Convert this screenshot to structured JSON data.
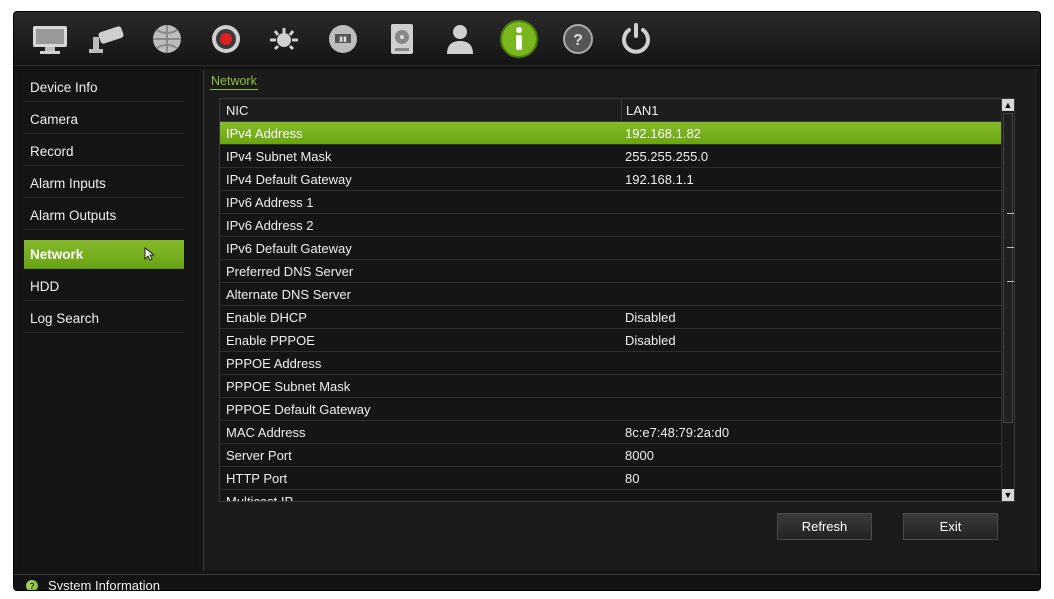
{
  "toolbar": {
    "icons": [
      {
        "name": "display-settings-icon"
      },
      {
        "name": "camera-setup-icon"
      },
      {
        "name": "network-settings-icon"
      },
      {
        "name": "recording-setup-icon"
      },
      {
        "name": "alarm-setup-icon"
      },
      {
        "name": "device-management-icon"
      },
      {
        "name": "hdd-storage-icon"
      },
      {
        "name": "user-management-icon"
      },
      {
        "name": "system-information-icon"
      },
      {
        "name": "help-icon"
      },
      {
        "name": "power-icon"
      }
    ],
    "active_icon": "system-information-icon",
    "accent_color": "#7ab61e"
  },
  "sidebar": {
    "items": [
      {
        "label": "Device Info"
      },
      {
        "label": "Camera"
      },
      {
        "label": "Record"
      },
      {
        "label": "Alarm Inputs"
      },
      {
        "label": "Alarm Outputs"
      },
      {
        "label": "Network"
      },
      {
        "label": "HDD"
      },
      {
        "label": "Log Search"
      }
    ],
    "active": "Network"
  },
  "main": {
    "breadcrumb": "Network",
    "table": {
      "header": {
        "name": "NIC",
        "value": "LAN1"
      },
      "rows": [
        {
          "name": "IPv4 Address",
          "value": "192.168.1.82",
          "selected": true
        },
        {
          "name": "IPv4 Subnet Mask",
          "value": "255.255.255.0"
        },
        {
          "name": "IPv4 Default Gateway",
          "value": "192.168.1.1"
        },
        {
          "name": "IPv6 Address 1",
          "value": ""
        },
        {
          "name": "IPv6 Address 2",
          "value": ""
        },
        {
          "name": "IPv6 Default Gateway",
          "value": ""
        },
        {
          "name": "Preferred DNS Server",
          "value": ""
        },
        {
          "name": "Alternate DNS Server",
          "value": ""
        },
        {
          "name": "Enable DHCP",
          "value": "Disabled"
        },
        {
          "name": "Enable PPPOE",
          "value": "Disabled"
        },
        {
          "name": "PPPOE Address",
          "value": ""
        },
        {
          "name": "PPPOE Subnet Mask",
          "value": ""
        },
        {
          "name": "PPPOE Default Gateway",
          "value": ""
        },
        {
          "name": "MAC Address",
          "value": "8c:e7:48:79:2a:d0"
        },
        {
          "name": "Server Port",
          "value": "8000"
        },
        {
          "name": "HTTP Port",
          "value": "80"
        },
        {
          "name": "Multicast IP",
          "value": ""
        }
      ]
    },
    "buttons": {
      "refresh": "Refresh",
      "exit": "Exit"
    }
  },
  "statusbar": {
    "text": "System Information"
  }
}
